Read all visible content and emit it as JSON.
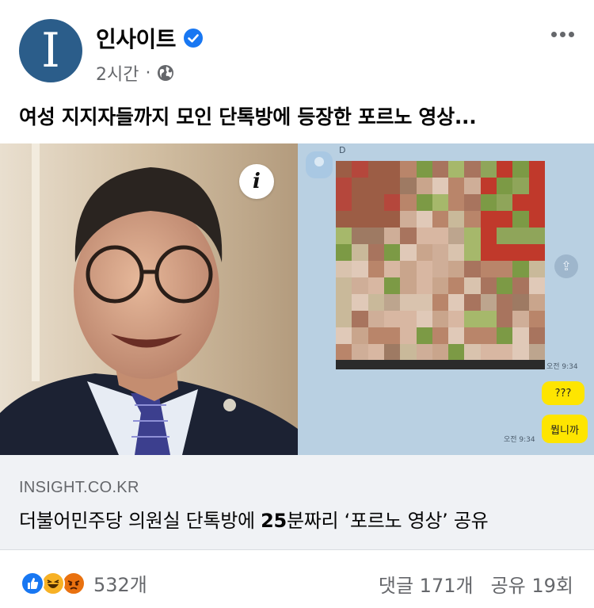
{
  "post": {
    "page_name": "인사이트",
    "avatar_letter": "I",
    "time": "2시간",
    "dot": "·",
    "caption": "여성 지지자들까지 모인 단톡방에 등장한 포르노 영상..."
  },
  "media": {
    "chat_sender": "D",
    "time_1": "오전 9:34",
    "bubble_1": "???",
    "bubble_2": "뭡니까",
    "time_2": "오전 9:34",
    "info_icon": "i"
  },
  "link": {
    "domain": "INSIGHT.CO.KR",
    "title_part1": "더불어민주당 의원실 단톡방에 ",
    "title_bold": "25",
    "title_part2": "분짜리 ‘포르노 영상’ 공유"
  },
  "footer": {
    "reaction_count": "532개",
    "comments": "댓글 171개",
    "shares": "공유 19회"
  },
  "icons": {
    "verified": "verified-badge-icon",
    "globe": "globe-icon",
    "more": "more-icon",
    "like": "like-reaction-icon",
    "haha": "haha-reaction-icon",
    "angry": "angry-reaction-icon"
  },
  "colors": {
    "brand": "#1877f2",
    "avatar": "#2b5d8a",
    "secondary_text": "#65676b",
    "kakao_bubble": "#fee500"
  }
}
